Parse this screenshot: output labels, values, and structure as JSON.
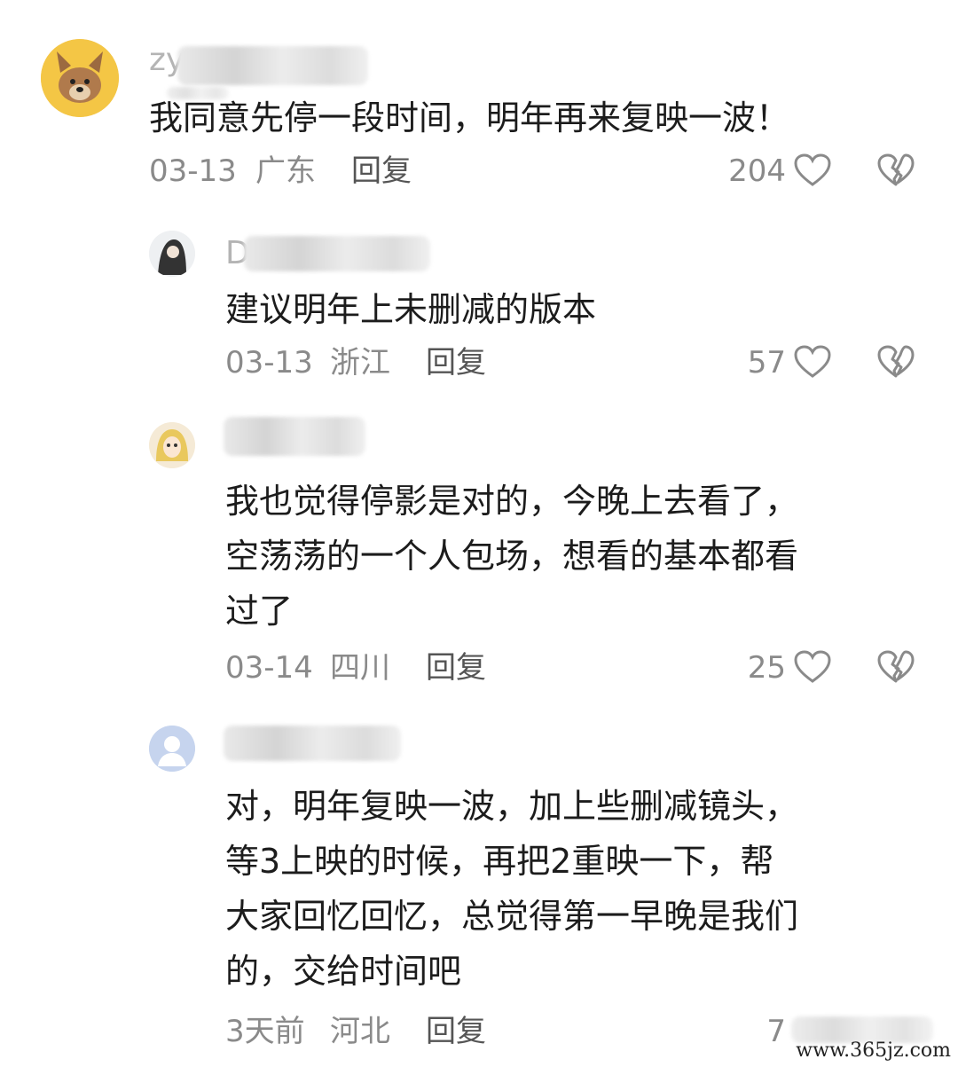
{
  "comments": [
    {
      "name_visible": "zy",
      "text_lines": [
        "我同意先停一段时间，明年再来复映一波！"
      ],
      "date": "03-13",
      "region": "广东",
      "reply": "回复",
      "likes": "204"
    },
    {
      "name_visible": "D",
      "text_lines": [
        "建议明年上未删减的版本"
      ],
      "date": "03-13",
      "region": "浙江",
      "reply": "回复",
      "likes": "57"
    },
    {
      "name_visible": "",
      "text_lines": [
        "我也觉得停影是对的，今晚上去看了，",
        "空荡荡的一个人包场，想看的基本都看",
        "过了"
      ],
      "date": "03-14",
      "region": "四川",
      "reply": "回复",
      "likes": "25"
    },
    {
      "name_visible": "",
      "text_lines": [
        "对，明年复映一波，加上些删减镜头，",
        "等3上映的时候，再把2重映一下，帮",
        "大家回忆回忆，总觉得第一早晚是我们",
        "的，交给时间吧"
      ],
      "date": "3天前",
      "region": "河北",
      "reply": "回复",
      "likes": "7"
    }
  ],
  "watermark": "www.365jz.com",
  "icons": {
    "like": "heart-outline-icon",
    "dislike": "broken-heart-icon"
  }
}
